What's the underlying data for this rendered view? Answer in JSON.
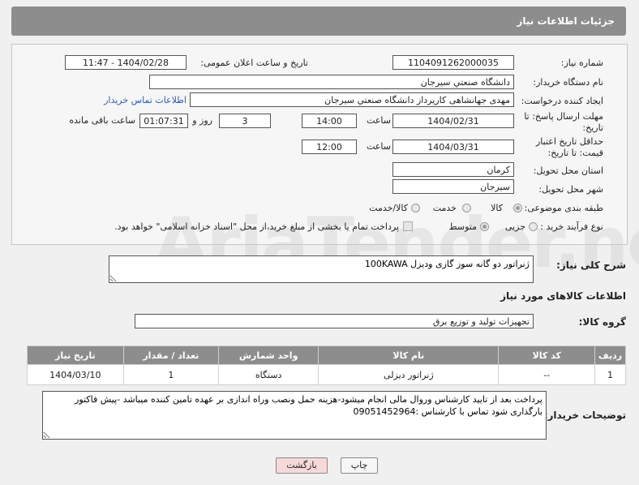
{
  "header": {
    "title": "جزئیات اطلاعات نیاز"
  },
  "fields": {
    "need_number_label": "شماره نیاز:",
    "need_number": "1104091262000035",
    "announce_label": "تاریخ و ساعت اعلان عمومی:",
    "announce_value": "1404/02/28 - 11:47",
    "buyer_org_label": "نام دستگاه خریدار:",
    "buyer_org": "دانشگاه صنعتي سيرجان",
    "creator_label": "ایجاد کننده درخواست:",
    "creator": "مهدی جهانشاهی کارپرداز دانشگاه صنعتي سيرجان",
    "contact_link": "اطلاعات تماس خریدار",
    "deadline_label": "مهلت ارسال پاسخ: تا تاریخ:",
    "deadline_date": "1404/02/31",
    "time_label": "ساعت",
    "deadline_time": "14:00",
    "days_value": "3",
    "days_label": "روز و",
    "remaining_time": "01:07:31",
    "remaining_label": "ساعت باقی مانده",
    "validity_label": "حداقل تاریخ اعتبار قیمت: تا تاریخ:",
    "validity_date": "1404/03/31",
    "validity_time": "12:00",
    "province_label": "استان محل تحویل:",
    "province": "کرمان",
    "city_label": "شهر محل تحویل:",
    "city": "سیرجان",
    "category_label": "طبقه بندی موضوعی:",
    "category_options": [
      "کالا",
      "خدمت",
      "کالا/خدمت"
    ],
    "process_label": "نوع فرآیند خرید :",
    "process_options": [
      "جزیی",
      "متوسط"
    ],
    "payment_note": "پرداخت تمام یا بخشی از مبلغ خرید،از محل \"اسناد خزانه اسلامی\" خواهد بود."
  },
  "description": {
    "label": "شرح کلی نیاز:",
    "value": "ژنراتور دو گانه سوز گازی ودیزل 100KAWA"
  },
  "goods_section": {
    "title": "اطلاعات کالاهای مورد نیاز",
    "group_label": "گروه کالا:",
    "group_value": "تجهیزات تولید و توزیع برق"
  },
  "table": {
    "headers": [
      "ردیف",
      "کد کالا",
      "نام کالا",
      "واحد شمارش",
      "تعداد / مقدار",
      "تاریخ نیاز"
    ],
    "rows": [
      [
        "1",
        "--",
        "ژنراتور دیزلی",
        "دستگاه",
        "1",
        "1404/03/10"
      ]
    ]
  },
  "buyer_notes": {
    "label": "توضیحات خریدار:",
    "value": "پرداخت بعد از تایید کارشناس وروال مالی انجام میشود-هزینه حمل ونصب وراه اندازی بر عهده تامین کننده میباشد -پیش فاکتور بارگذاری شود تماس با کارشناس :09051452964"
  },
  "buttons": {
    "print": "چاپ",
    "back": "بازگشت"
  },
  "watermark": "AriaTender.neT",
  "colors": {
    "header_bg": "#8d8d8d",
    "link": "#2a5db0",
    "back_button_bg": "#f7d9d9"
  }
}
